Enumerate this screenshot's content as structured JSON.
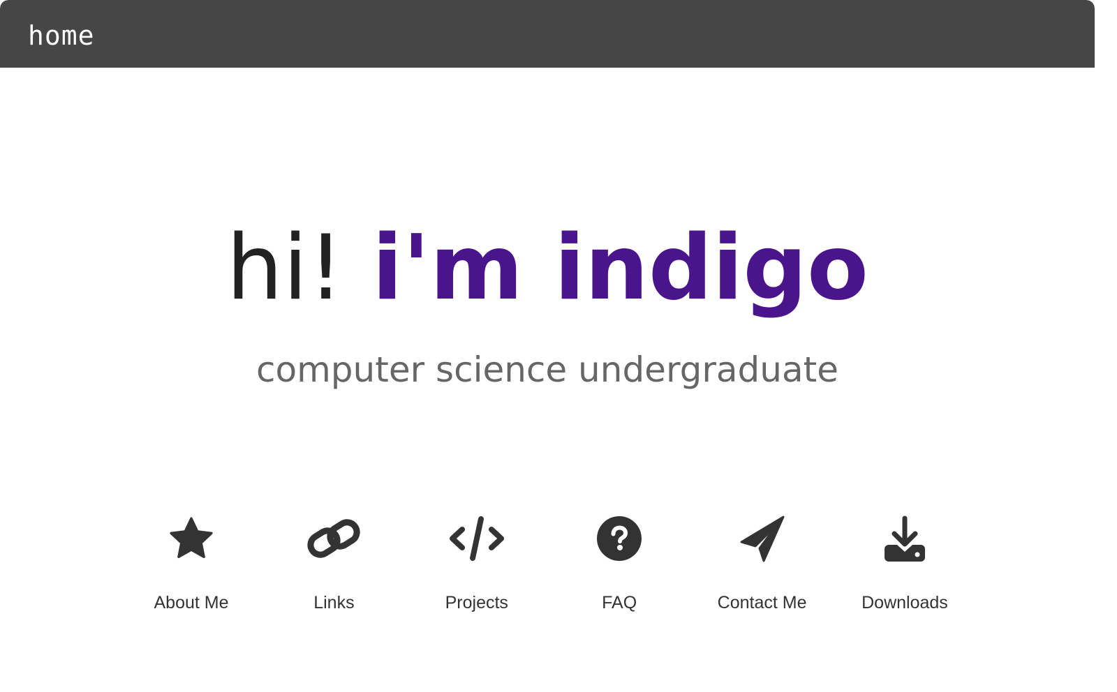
{
  "window": {
    "title": "home"
  },
  "hero": {
    "greeting": "hi!",
    "name": "i'm indigo",
    "subtitle": "computer science undergraduate"
  },
  "nav": {
    "items": [
      {
        "label": "About Me",
        "icon": "star-icon"
      },
      {
        "label": "Links",
        "icon": "link-icon"
      },
      {
        "label": "Projects",
        "icon": "code-icon"
      },
      {
        "label": "FAQ",
        "icon": "question-circle-icon"
      },
      {
        "label": "Contact Me",
        "icon": "paper-plane-icon"
      },
      {
        "label": "Downloads",
        "icon": "download-icon"
      }
    ]
  },
  "colors": {
    "titlebar": "#464646",
    "accent": "#4a148c",
    "text": "#222222",
    "subtitle": "#666666",
    "icon": "#333333"
  }
}
